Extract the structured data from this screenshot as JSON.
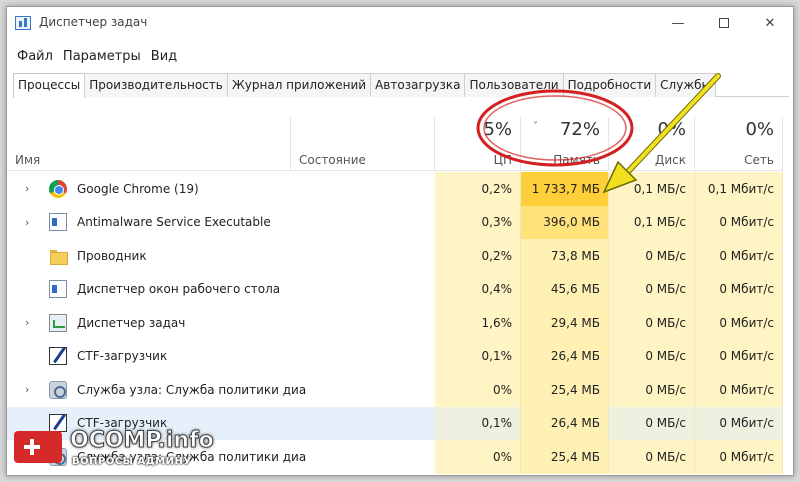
{
  "window": {
    "title": "Диспетчер задач"
  },
  "menu": [
    "Файл",
    "Параметры",
    "Вид"
  ],
  "tabs": [
    "Процессы",
    "Производительность",
    "Журнал приложений",
    "Автозагрузка",
    "Пользователи",
    "Подробности",
    "Службы"
  ],
  "columns": {
    "name": "Имя",
    "status": "Состояние",
    "cpu_pct": "5%",
    "cpu_label": "ЦП",
    "mem_pct": "72%",
    "mem_label": "Память",
    "disk_pct": "0%",
    "disk_label": "Диск",
    "net_pct": "0%",
    "net_label": "Сеть"
  },
  "processes": [
    {
      "name": "Google Chrome (19)",
      "icon": "chrome-icon",
      "expandable": true,
      "cpu": "0,2%",
      "mem": "1 733,7 МБ",
      "disk": "0,1 МБ/с",
      "net": "0,1 Мбит/с"
    },
    {
      "name": "Antimalware Service Executable",
      "icon": "window-app-icon",
      "expandable": true,
      "cpu": "0,3%",
      "mem": "396,0 МБ",
      "disk": "0,1 МБ/с",
      "net": "0 Мбит/с"
    },
    {
      "name": "Проводник",
      "icon": "folder-icon",
      "expandable": false,
      "cpu": "0,2%",
      "mem": "73,8 МБ",
      "disk": "0 МБ/с",
      "net": "0 Мбит/с"
    },
    {
      "name": "Диспетчер окон рабочего стола",
      "icon": "window-app-icon",
      "expandable": false,
      "cpu": "0,4%",
      "mem": "45,6 МБ",
      "disk": "0 МБ/с",
      "net": "0 Мбит/с"
    },
    {
      "name": "Диспетчер задач",
      "icon": "task-manager-icon",
      "expandable": true,
      "cpu": "1,6%",
      "mem": "29,4 МБ",
      "disk": "0 МБ/с",
      "net": "0 Мбит/с"
    },
    {
      "name": "CTF-загрузчик",
      "icon": "ctf-loader-icon",
      "expandable": false,
      "cpu": "0,1%",
      "mem": "26,4 МБ",
      "disk": "0 МБ/с",
      "net": "0 Мбит/с"
    },
    {
      "name": "Служба узла: Служба политики диаг...",
      "icon": "service-gear-icon",
      "expandable": true,
      "cpu": "0%",
      "mem": "25,4 МБ",
      "disk": "0 МБ/с",
      "net": "0 Мбит/с"
    },
    {
      "name": "CTF-загрузчик",
      "icon": "ctf-loader-icon",
      "expandable": false,
      "cpu": "0,1%",
      "mem": "26,4 МБ",
      "disk": "0 МБ/с",
      "net": "0 Мбит/с",
      "selected": true
    },
    {
      "name": "Служба узла: Служба политики диаг...",
      "icon": "service-gear-icon",
      "expandable": true,
      "cpu": "0%",
      "mem": "25,4 МБ",
      "disk": "0 МБ/с",
      "net": "0 Мбит/с"
    }
  ],
  "colors": {
    "cpu_bg": "#fff4c4",
    "mem_high": "#ffcf3a",
    "mem_mid": "#ffe27a",
    "mem_low": "#fff0b3",
    "disk_bg": "#fff4c4",
    "net_bg": "#fff4c4",
    "annotation": "#d42020",
    "arrow": "#f0e020"
  },
  "watermark": {
    "title": "OCOMP.info",
    "subtitle": "ВОПРОСЫ АДМИНУ"
  }
}
